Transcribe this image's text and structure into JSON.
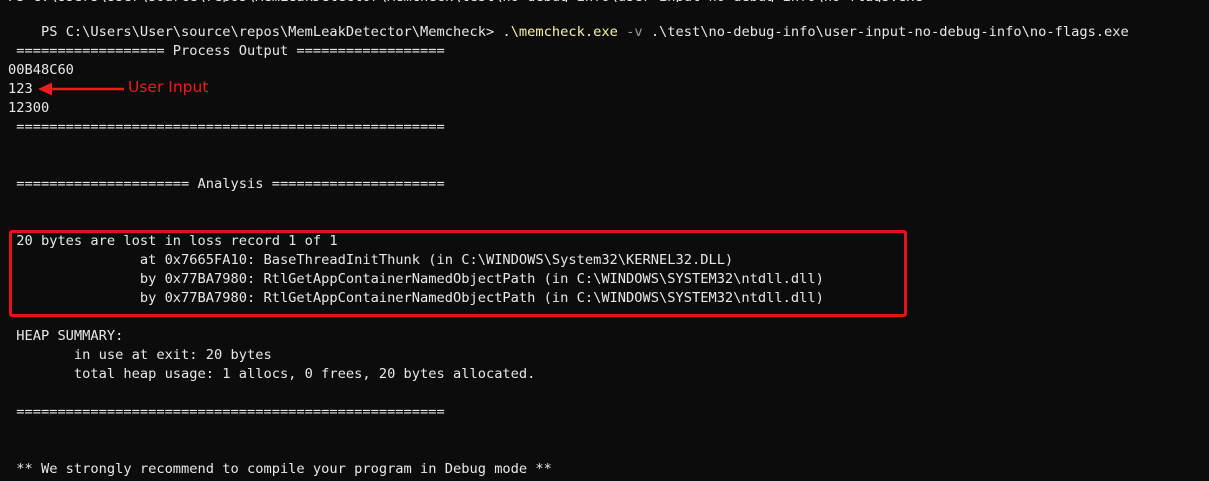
{
  "prompt": {
    "path": "PS C:\\Users\\User\\source\\repos\\MemLeakDetector\\Memcheck>",
    "command": ".\\memcheck.exe",
    "flag": "-v",
    "argument": ".\\test\\no-debug-info\\user-input-no-debug-info\\no-flags.exe"
  },
  "process_output": {
    "header": " ================== Process Output ==================",
    "lines": [
      "00B48C60",
      "123",
      "12300"
    ],
    "footer": " ===================================================="
  },
  "annotation": {
    "label": "User Input",
    "color": "#ee1c1c"
  },
  "analysis": {
    "header": " ===================== Analysis ====================="
  },
  "loss_record": {
    "summary": " 20 bytes are lost in loss record 1 of 1",
    "frames": [
      "                at 0x7665FA10: BaseThreadInitThunk (in C:\\WINDOWS\\System32\\KERNEL32.DLL)",
      "                by 0x77BA7980: RtlGetAppContainerNamedObjectPath (in C:\\WINDOWS\\SYSTEM32\\ntdll.dll)",
      "                by 0x77BA7980: RtlGetAppContainerNamedObjectPath (in C:\\WINDOWS\\SYSTEM32\\ntdll.dll)"
    ],
    "highlight_color": "#e5121b"
  },
  "heap_summary": {
    "title": " HEAP SUMMARY:",
    "in_use": "        in use at exit: 20 bytes",
    "total": "        total heap usage: 1 allocs, 0 frees, 20 bytes allocated.",
    "footer": " ===================================================="
  },
  "recommendation": " ** We strongly recommend to compile your program in Debug mode **",
  "colors": {
    "background": "#0c0c0c",
    "text": "#e8e8e8",
    "command": "#f9f1a5",
    "flag": "#9a9a9a"
  }
}
